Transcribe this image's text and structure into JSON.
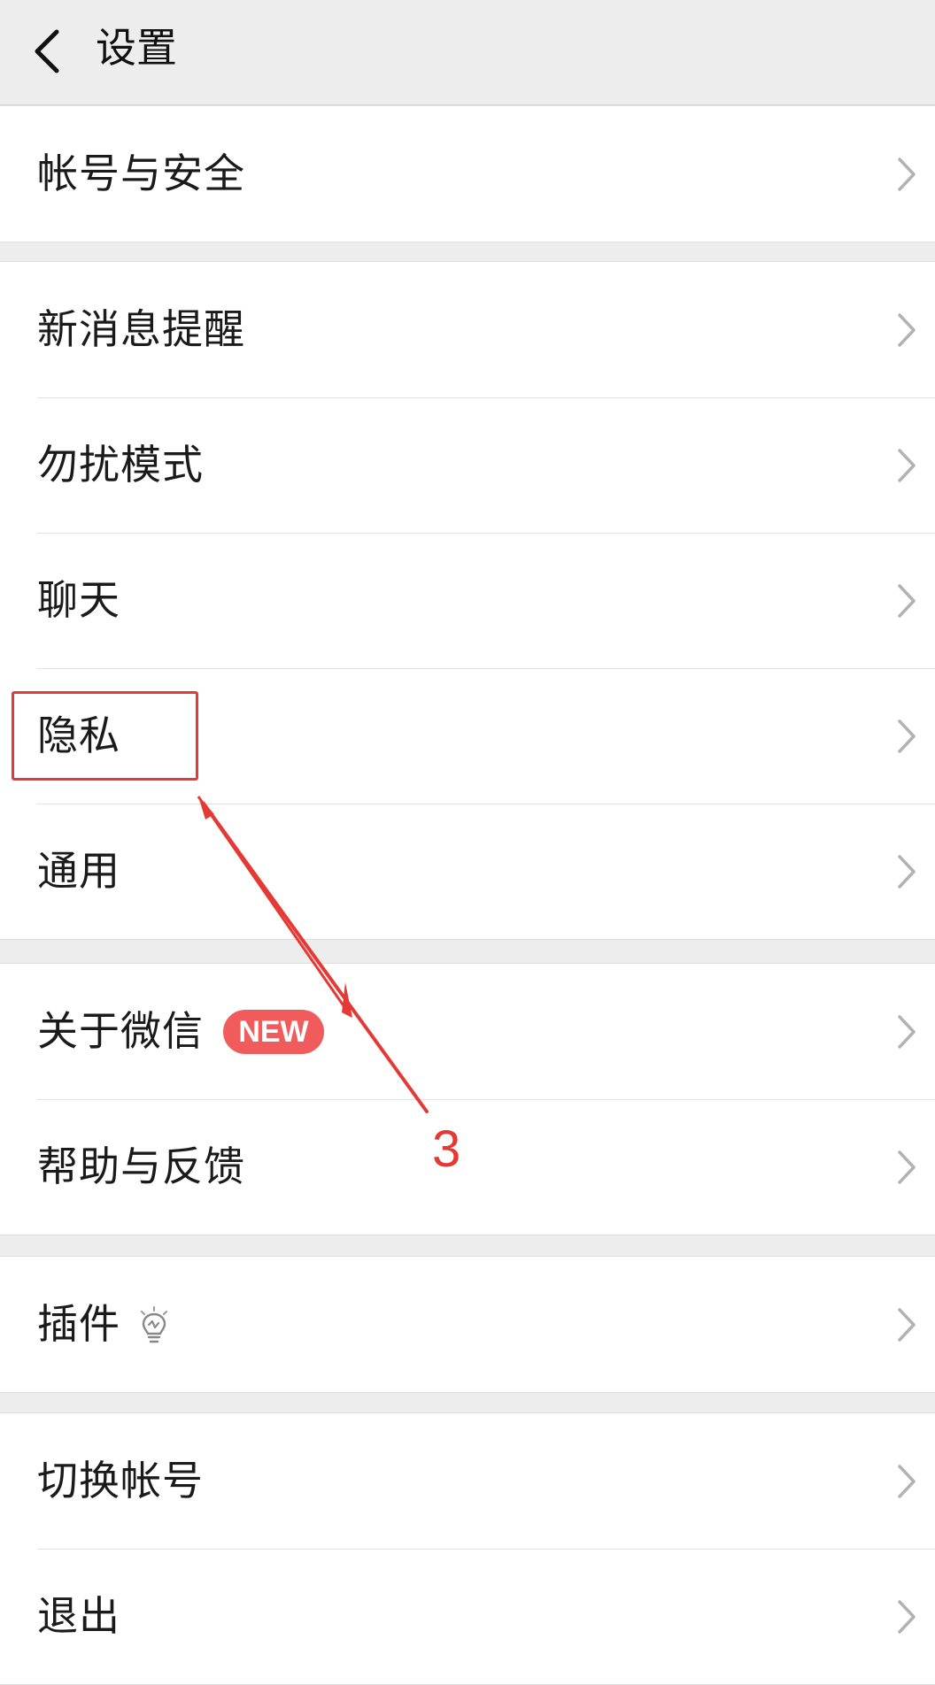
{
  "header": {
    "title": "设置"
  },
  "groups": [
    {
      "items": [
        {
          "label": "帐号与安全"
        }
      ]
    },
    {
      "items": [
        {
          "label": "新消息提醒"
        },
        {
          "label": "勿扰模式"
        },
        {
          "label": "聊天"
        },
        {
          "label": "隐私"
        },
        {
          "label": "通用"
        }
      ]
    },
    {
      "items": [
        {
          "label": "关于微信",
          "badge": "NEW"
        },
        {
          "label": "帮助与反馈"
        }
      ]
    },
    {
      "items": [
        {
          "label": "插件",
          "icon": "lightbulb-icon"
        }
      ]
    },
    {
      "items": [
        {
          "label": "切换帐号"
        },
        {
          "label": "退出"
        }
      ]
    }
  ],
  "annotation": {
    "step": "3",
    "color": "#e53935",
    "target": "隐私"
  },
  "colors": {
    "badge": "#f25b5b",
    "background": "#ededed",
    "row": "#ffffff"
  }
}
